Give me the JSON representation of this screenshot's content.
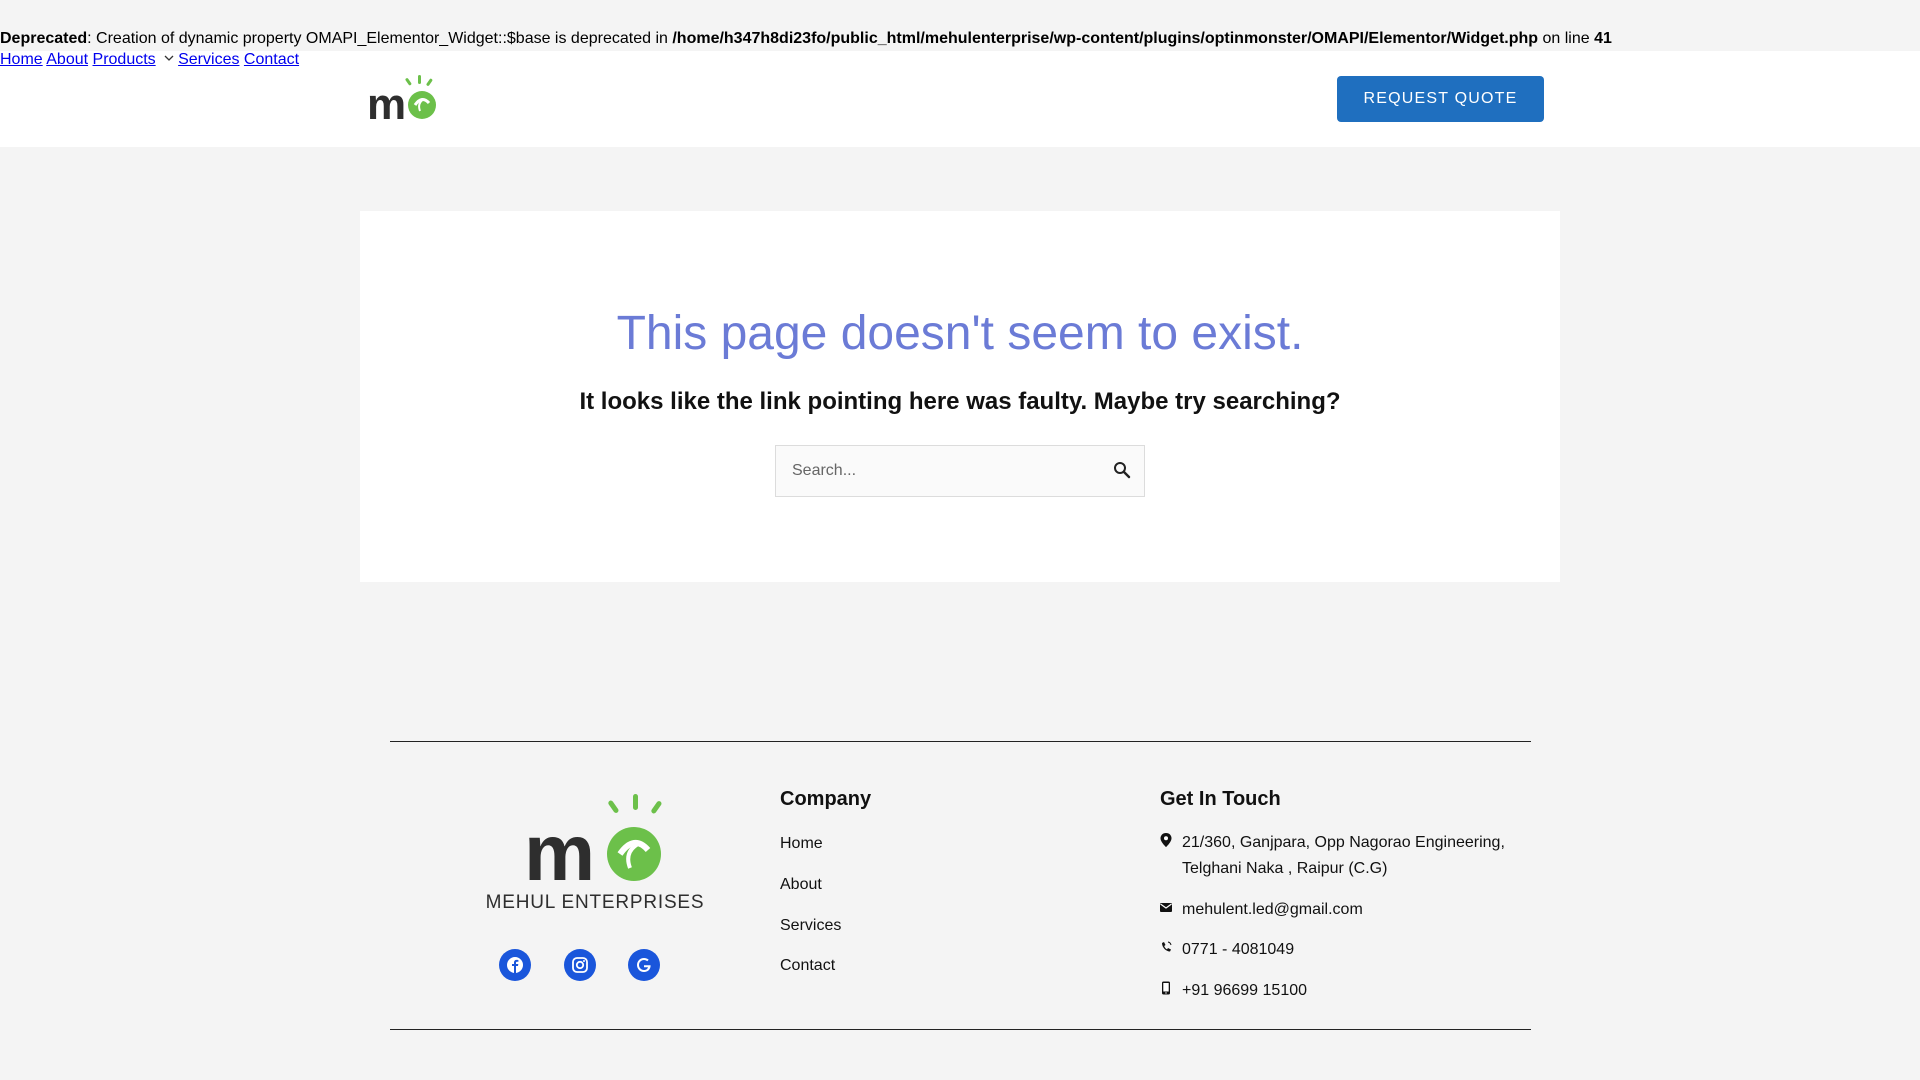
{
  "notice": {
    "label": "Deprecated",
    "text1": ": Creation of dynamic property OMAPI_Elementor_Widget::$base is deprecated in ",
    "path": "/home/h347h8di23fo/public_html/mehulenterprise/wp-content/plugins/optinmonster/OMAPI/Elementor/Widget.php",
    "text2": " on line ",
    "line": "41"
  },
  "header": {
    "nav": [
      {
        "label": "Home"
      },
      {
        "label": "About"
      },
      {
        "label": "Products"
      },
      {
        "label": "Services"
      },
      {
        "label": "Contact"
      }
    ],
    "cta_label": "Request Quote"
  },
  "error": {
    "title": "This page doesn't seem to exist.",
    "subtitle": "It looks like the link pointing here was faulty. Maybe try searching?",
    "search_placeholder": "Search..."
  },
  "footer": {
    "brand_name": "MEHUL ENTERPRISES",
    "company": {
      "heading": "Company",
      "links": [
        "Home",
        "About",
        "Services",
        "Contact"
      ]
    },
    "contact": {
      "heading": "Get In Touch",
      "address_line1": "21/360, Ganjpara, Opp Nagorao Engineering,",
      "address_line2": "Telghani Naka , Raipur (C.G)",
      "email": "mehulent.led@gmail.com",
      "phone": "0771 - 4081049",
      "mobile": "+91 96699 15100"
    },
    "social": [
      "facebook-icon",
      "instagram-icon",
      "google-icon"
    ]
  },
  "colors": {
    "accent": "#1f6fbf",
    "title": "#6b7bd6",
    "brand_green": "#6cc04a",
    "brand_dark": "#2e2e2e",
    "social": "#1a56db"
  }
}
